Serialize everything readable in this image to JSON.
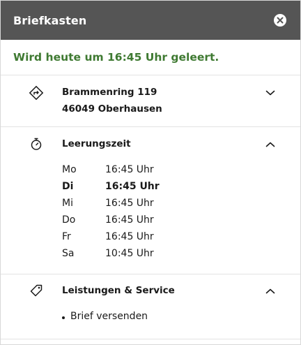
{
  "header": {
    "title": "Briefkasten"
  },
  "status": {
    "text": "Wird heute um 16:45 Uhr geleert."
  },
  "address": {
    "street": "Brammenring 119",
    "city": "46049 Oberhausen"
  },
  "schedule": {
    "title": "Leerungszeit",
    "rows": [
      {
        "day": "Mo",
        "time": "16:45 Uhr",
        "today": false
      },
      {
        "day": "Di",
        "time": "16:45 Uhr",
        "today": true
      },
      {
        "day": "Mi",
        "time": "16:45 Uhr",
        "today": false
      },
      {
        "day": "Do",
        "time": "16:45 Uhr",
        "today": false
      },
      {
        "day": "Fr",
        "time": "16:45 Uhr",
        "today": false
      },
      {
        "day": "Sa",
        "time": "10:45 Uhr",
        "today": false
      }
    ]
  },
  "services": {
    "title": "Leistungen & Service",
    "items": [
      "Brief versenden"
    ]
  },
  "colors": {
    "header_bg": "#555555",
    "status_green": "#3f7a32",
    "divider": "#e3e3e3"
  }
}
